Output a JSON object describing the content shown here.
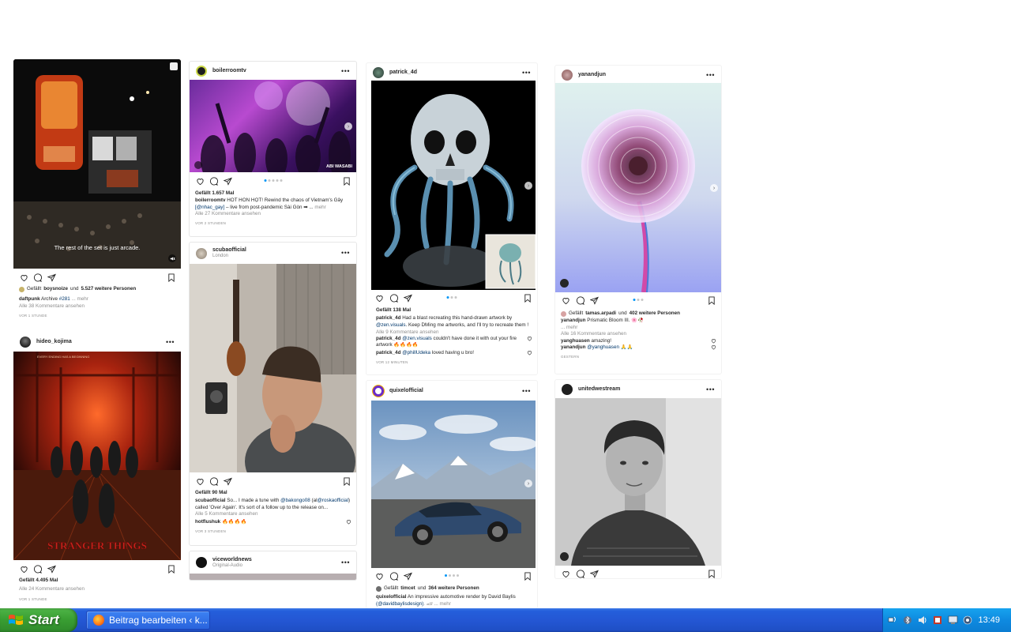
{
  "feed": {
    "col1": {
      "post1": {
        "caption_overlay": "The rest of the set is just arcade.",
        "liked_by_user": "boysnoize",
        "likes_rest": "5.527 weitere Personen",
        "liked_prefix": "Gefällt",
        "liked_and": "und",
        "caption_user": "daftpunk",
        "caption_text": "Archive",
        "caption_tag": "#281",
        "caption_more": "... mehr",
        "comments_link": "Alle 38 Kommentare ansehen",
        "time": "VOR 1 STUNDE"
      },
      "post2": {
        "username": "hideo_kojima",
        "poster_title": "STRANGER THINGS",
        "poster_tagline": "EVERY ENDING HAS A BEGINNING",
        "likes": "Gefällt 4.495 Mal",
        "comments_link": "Alle 24 Kommentare ansehen",
        "time": "VOR 1 STUNDE"
      }
    },
    "col2": {
      "post1": {
        "username": "boilerroomtv",
        "media_badge": "ABI WASABI",
        "likes": "Gefällt 1.657 Mal",
        "caption_user": "boilerroomtv",
        "caption_line1": "HÓT HÒN HỌT! Rewind the chaos of Vietnam's Gây",
        "caption_mention": "[@nhac_gay]",
        "caption_line2": "– live from post-pandemic Sài Gòn ➡ ...",
        "caption_more": "mehr",
        "comments_link": "Alle 27 Kommentare ansehen",
        "time": "VOR 2 STUNDEN"
      },
      "post2": {
        "username": "scubaofficial",
        "location": "London",
        "likes": "Gefällt 90 Mal",
        "caption_user": "scubaofficial",
        "caption_a": "So... I made a tune with",
        "caption_m1": "@bakongo08",
        "caption_b": "(al",
        "caption_m2": "@roskaofficial",
        "caption_c": ")",
        "caption_line2": "called 'Over Again'. It's sort of a follow up to the release on...",
        "comments_link": "Alle 5 Kommentare ansehen",
        "comment_user": "hotflushuk",
        "comment_text": "🔥🔥🔥🔥",
        "time": "VOR 3 STUNDEN"
      },
      "post3": {
        "username": "viceworldnews",
        "subtitle": "Original-Audio"
      }
    },
    "col3": {
      "post1": {
        "username": "patrick_4d",
        "likes": "Gefällt 138 Mal",
        "caption_user": "patrick_4d",
        "caption_line1": "Had a blast recreating this hand-drawn artwork by",
        "caption_mention": "@zen.visuals",
        "caption_line2": ". Keep DMing me artworks, and I'll try to recreate them !",
        "comments_link": "Alle 9 Kommentare ansehen",
        "c1_user": "patrick_4d",
        "c1_mention": "@zen.visuals",
        "c1_text": "couldn't have done it with out your fire",
        "c1_text2": "artwork 🔥🔥🔥🔥",
        "c2_user": "patrick_4d",
        "c2_mention": "@phillUdeka",
        "c2_text": "loved having u bro!",
        "time": "VOR 12 MINUTEN"
      },
      "post2": {
        "username": "quixelofficial",
        "liked_prefix": "Gefällt",
        "liked_by_user": "timcet",
        "liked_and": "und",
        "likes_rest": "364 weitere Personen",
        "caption_user": "quixelofficial",
        "caption_text": "An impressive automotive render by David Baylis",
        "caption_mention": "(@davidbaylisdesign)",
        "caption_tail": ". 🏎 ... mehr"
      }
    },
    "col4": {
      "post1": {
        "username": "yanandjun",
        "liked_prefix": "Gefällt",
        "liked_by_user": "tamas.arpadi",
        "liked_and": "und",
        "likes_rest": "402 weitere Personen",
        "caption_user": "yanandjun",
        "caption_text": "Prismatic Bloom III. 🌸🥀",
        "caption_more": "... mehr",
        "comments_link": "Alle 16 Kommentare ansehen",
        "c1_user": "yanghuasen",
        "c1_text": "amazing!",
        "c2_user": "yanandjun",
        "c2_mention": "@yanghuasen",
        "c2_text": "🙏🙏",
        "time": "GESTERN"
      },
      "post2": {
        "username": "unitedwestream"
      }
    }
  },
  "taskbar": {
    "start_label": "Start",
    "window_title": "Beitrag bearbeiten ‹ k...",
    "clock": "13:49"
  },
  "colors": {
    "link": "#00376b",
    "accent_dot": "#0095f6",
    "taskbar_blue": "#245edb",
    "start_green": "#3a9f33"
  },
  "icons": [
    "heart-icon",
    "comment-icon",
    "share-icon",
    "bookmark-icon",
    "more-icon",
    "mute-icon",
    "chevron-right-icon",
    "user-tag-icon"
  ]
}
